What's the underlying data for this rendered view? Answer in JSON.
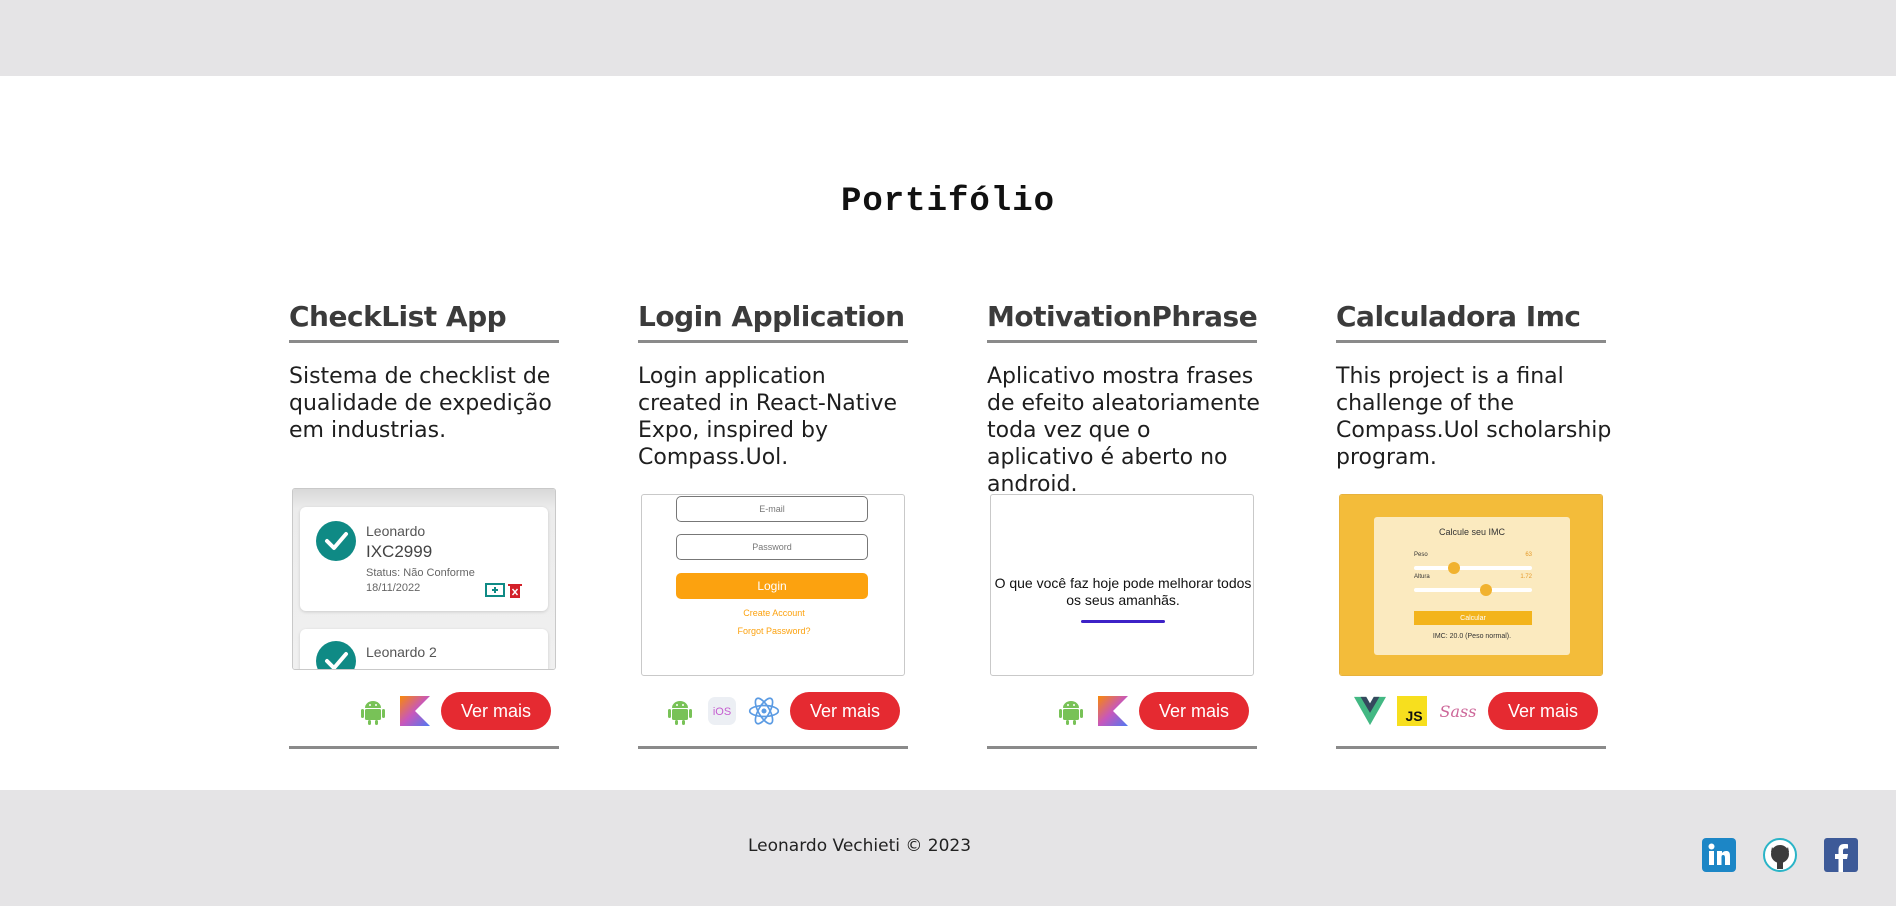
{
  "page_title": "Portifólio",
  "projects": [
    {
      "title": "CheckList App",
      "description": "Sistema de checklist de qualidade de expedição em industrias.",
      "button": "Ver mais",
      "tech": [
        "android-icon",
        "kotlin-icon"
      ],
      "preview": {
        "item1_name": "Leonardo",
        "item1_code": "IXC2999",
        "item1_status": "Status: Não Conforme",
        "item1_date": "18/11/2022",
        "item2_name": "Leonardo 2"
      }
    },
    {
      "title": "Login Application",
      "description": "Login application created in React-Native Expo, inspired by Compass.Uol.",
      "button": "Ver mais",
      "tech": [
        "android-icon",
        "ios-icon",
        "react-icon"
      ],
      "preview": {
        "email_placeholder": "E-mail",
        "password_placeholder": "Password",
        "login_label": "Login",
        "create_account": "Create Account",
        "forgot_password": "Forgot Password?"
      }
    },
    {
      "title": "MotivationPhrase",
      "description": "Aplicativo mostra frases de efeito aleatoriamente toda vez que o aplicativo é aberto no android.",
      "button": "Ver mais",
      "tech": [
        "android-icon",
        "kotlin-icon"
      ],
      "preview": {
        "phrase": "O que você faz hoje pode melhorar todos os seus amanhãs."
      }
    },
    {
      "title": "Calculadora Imc",
      "description": "This project is a final challenge of the Compass.Uol scholarship program.",
      "button": "Ver mais",
      "tech": [
        "vue-icon",
        "javascript-icon",
        "sass-icon"
      ],
      "preview": {
        "heading": "Calcule seu IMC",
        "weight_label": "Peso",
        "weight_value": "63",
        "height_label": "Altura",
        "height_value": "1.72",
        "button_label": "Calcular",
        "result": "IMC: 20.0 (Peso normal)."
      }
    }
  ],
  "footer": {
    "copyright": "Leonardo Vechieti © 2023",
    "social": [
      "linkedin-icon",
      "github-icon",
      "facebook-icon"
    ]
  },
  "colors": {
    "accent_button": "#e52a31",
    "band": "#e5e4e6"
  }
}
